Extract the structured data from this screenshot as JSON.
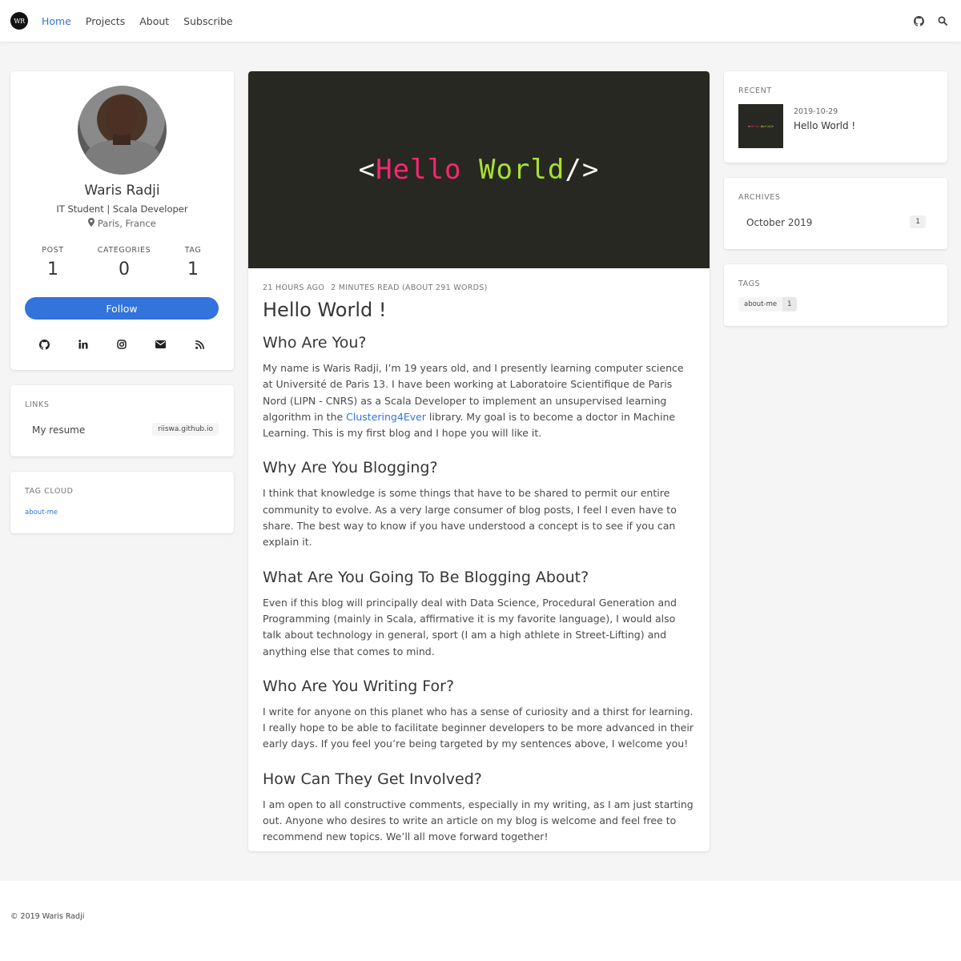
{
  "nav": {
    "logo_text": "WR",
    "links": [
      "Home",
      "Projects",
      "About",
      "Subscribe"
    ],
    "icons": [
      "github-icon",
      "search-icon"
    ]
  },
  "profile": {
    "name": "Waris Radji",
    "title": "IT Student | Scala Developer",
    "location": "Paris, France",
    "stats": [
      {
        "label": "POST",
        "value": "1"
      },
      {
        "label": "CATEGORIES",
        "value": "0"
      },
      {
        "label": "TAG",
        "value": "1"
      }
    ],
    "follow_label": "Follow",
    "social_icons": [
      "github-icon",
      "linkedin-icon",
      "instagram-icon",
      "email-icon",
      "rss-icon"
    ]
  },
  "links_card": {
    "title": "LINKS",
    "items": [
      {
        "label": "My resume",
        "tag": "riiswa.github.io"
      }
    ]
  },
  "tag_cloud": {
    "title": "TAG CLOUD",
    "tags": [
      "about-me"
    ]
  },
  "post": {
    "hero": {
      "open": "<",
      "word1": "Hello",
      "word2": "World",
      "close": "/>"
    },
    "meta_time": "21 HOURS AGO",
    "meta_read": "2 MINUTES READ (ABOUT 291 WORDS)",
    "title": "Hello World !",
    "sections": [
      {
        "heading": "Who Are You?"
      },
      {
        "heading": "Why Are You Blogging?",
        "text": "I think that knowledge is some things that have to be shared to permit our entire community to evolve. As a very large consumer of blog posts, I feel I even have to share. The best way to know if you have understood a concept is to see if you can explain it."
      },
      {
        "heading": "What Are You Going To Be Blogging About?",
        "text": "Even if this blog will principally deal with Data Science, Procedural Generation and Programming (mainly in Scala, affirmative it is my favorite language), I would also talk about technology in general, sport (I am a high athlete in Street-Lifting) and anything else that comes to mind."
      },
      {
        "heading": "Who Are You Writing For?",
        "text": "I write for anyone on this planet who has a sense of curiosity and a thirst for learning. I really hope to be able to facilitate beginner developers to be more advanced in their early days. If you feel you’re being targeted by my sentences above, I welcome you!"
      },
      {
        "heading": "How Can They Get Involved?",
        "text": "I am open to all constructive comments, especially in my writing, as I am just starting out. Anyone who desires to write an article on my blog is welcome and feel free to recommend new topics. We’ll all move forward together!"
      }
    ],
    "intro_before_link": "My name is Waris Radji, I’m 19 years old, and I presently learning computer science at Université de Paris 13. I have been working at Laboratoire Scientifique de Paris Nord (LIPN - CNRS) as a Scala Developer to implement an unsupervised learning algorithm in the ",
    "intro_link": "Clustering4Ever",
    "intro_after_link": " library. My goal is to become a doctor in Machine Learning. This is my first blog and I hope you will like it."
  },
  "recent": {
    "title": "RECENT",
    "date": "2019-10-29",
    "post_title": "Hello World !"
  },
  "archives": {
    "title": "ARCHIVES",
    "items": [
      {
        "label": "October 2019",
        "count": "1"
      }
    ]
  },
  "tags": {
    "title": "TAGS",
    "items": [
      {
        "name": "about-me",
        "count": "1"
      }
    ]
  },
  "footer": {
    "text": "© 2019 Waris Radji"
  },
  "colors": {
    "accent": "#3273dc",
    "hero_bg": "#272822",
    "hero_pink": "#f92672",
    "hero_green": "#a6e22e"
  }
}
